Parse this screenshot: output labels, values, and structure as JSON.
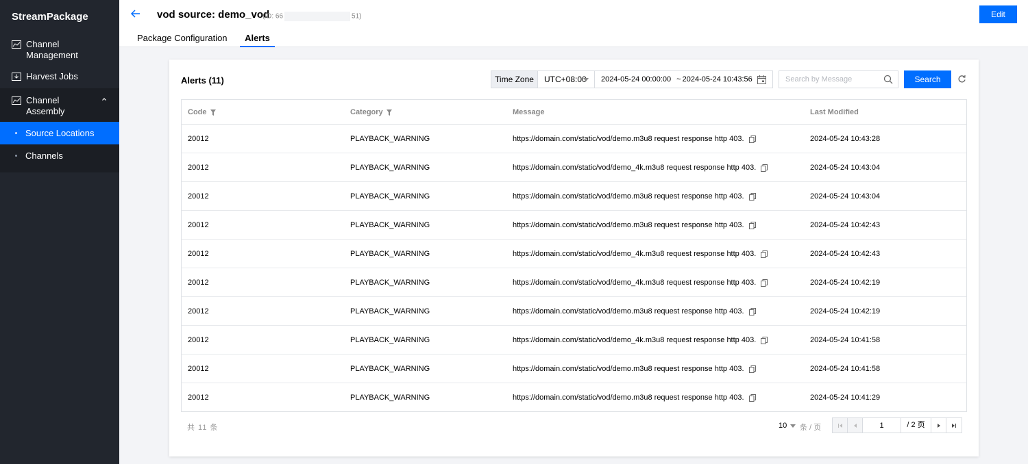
{
  "sidebar": {
    "brand": "StreamPackage",
    "items": [
      {
        "label": "Channel Management",
        "icon": "chart-icon"
      },
      {
        "label": "Harvest Jobs",
        "icon": "download-icon"
      },
      {
        "label": "Channel Assembly",
        "icon": "chart-icon",
        "expanded": true
      }
    ],
    "subitems": [
      {
        "label": "Source Locations",
        "active": true
      },
      {
        "label": "Channels",
        "active": false
      }
    ]
  },
  "header": {
    "title": "vod source: demo_vod",
    "id_prefix": "(ID: 66",
    "id_suffix": "51)",
    "edit_label": "Edit",
    "tabs": [
      {
        "label": "Package Configuration",
        "active": false
      },
      {
        "label": "Alerts",
        "active": true
      }
    ]
  },
  "alerts": {
    "title": "Alerts (11)",
    "timezone_label": "Time Zone",
    "timezone_value": "UTC+08:00",
    "date_start": "2024-05-24 00:00:00",
    "date_sep": "~",
    "date_end": "2024-05-24 10:43:56",
    "search_placeholder": "Search by Message",
    "search_label": "Search"
  },
  "table": {
    "columns": [
      "Code",
      "Category",
      "Message",
      "Last Modified"
    ],
    "rows": [
      {
        "code": "20012",
        "category": "PLAYBACK_WARNING",
        "message": "https://domain.com/static/vod/demo.m3u8 request response http 403.",
        "time": "2024-05-24 10:43:28"
      },
      {
        "code": "20012",
        "category": "PLAYBACK_WARNING",
        "message": "https://domain.com/static/vod/demo_4k.m3u8 request response http 403.",
        "time": "2024-05-24 10:43:04"
      },
      {
        "code": "20012",
        "category": "PLAYBACK_WARNING",
        "message": "https://domain.com/static/vod/demo.m3u8 request response http 403.",
        "time": "2024-05-24 10:43:04"
      },
      {
        "code": "20012",
        "category": "PLAYBACK_WARNING",
        "message": "https://domain.com/static/vod/demo.m3u8 request response http 403.",
        "time": "2024-05-24 10:42:43"
      },
      {
        "code": "20012",
        "category": "PLAYBACK_WARNING",
        "message": "https://domain.com/static/vod/demo_4k.m3u8 request response http 403.",
        "time": "2024-05-24 10:42:43"
      },
      {
        "code": "20012",
        "category": "PLAYBACK_WARNING",
        "message": "https://domain.com/static/vod/demo_4k.m3u8 request response http 403.",
        "time": "2024-05-24 10:42:19"
      },
      {
        "code": "20012",
        "category": "PLAYBACK_WARNING",
        "message": "https://domain.com/static/vod/demo.m3u8 request response http 403.",
        "time": "2024-05-24 10:42:19"
      },
      {
        "code": "20012",
        "category": "PLAYBACK_WARNING",
        "message": "https://domain.com/static/vod/demo_4k.m3u8 request response http 403.",
        "time": "2024-05-24 10:41:58"
      },
      {
        "code": "20012",
        "category": "PLAYBACK_WARNING",
        "message": "https://domain.com/static/vod/demo.m3u8 request response http 403.",
        "time": "2024-05-24 10:41:58"
      },
      {
        "code": "20012",
        "category": "PLAYBACK_WARNING",
        "message": "https://domain.com/static/vod/demo.m3u8 request response http 403.",
        "time": "2024-05-24 10:41:29"
      }
    ]
  },
  "pagination": {
    "total_text": "共 11 条",
    "page_size": "10",
    "per_page_text": "条 / 页",
    "current_page": "1",
    "total_pages_text": "/ 2 页"
  },
  "colors": {
    "primary": "#006eff",
    "sidebar_bg": "#22262e"
  }
}
